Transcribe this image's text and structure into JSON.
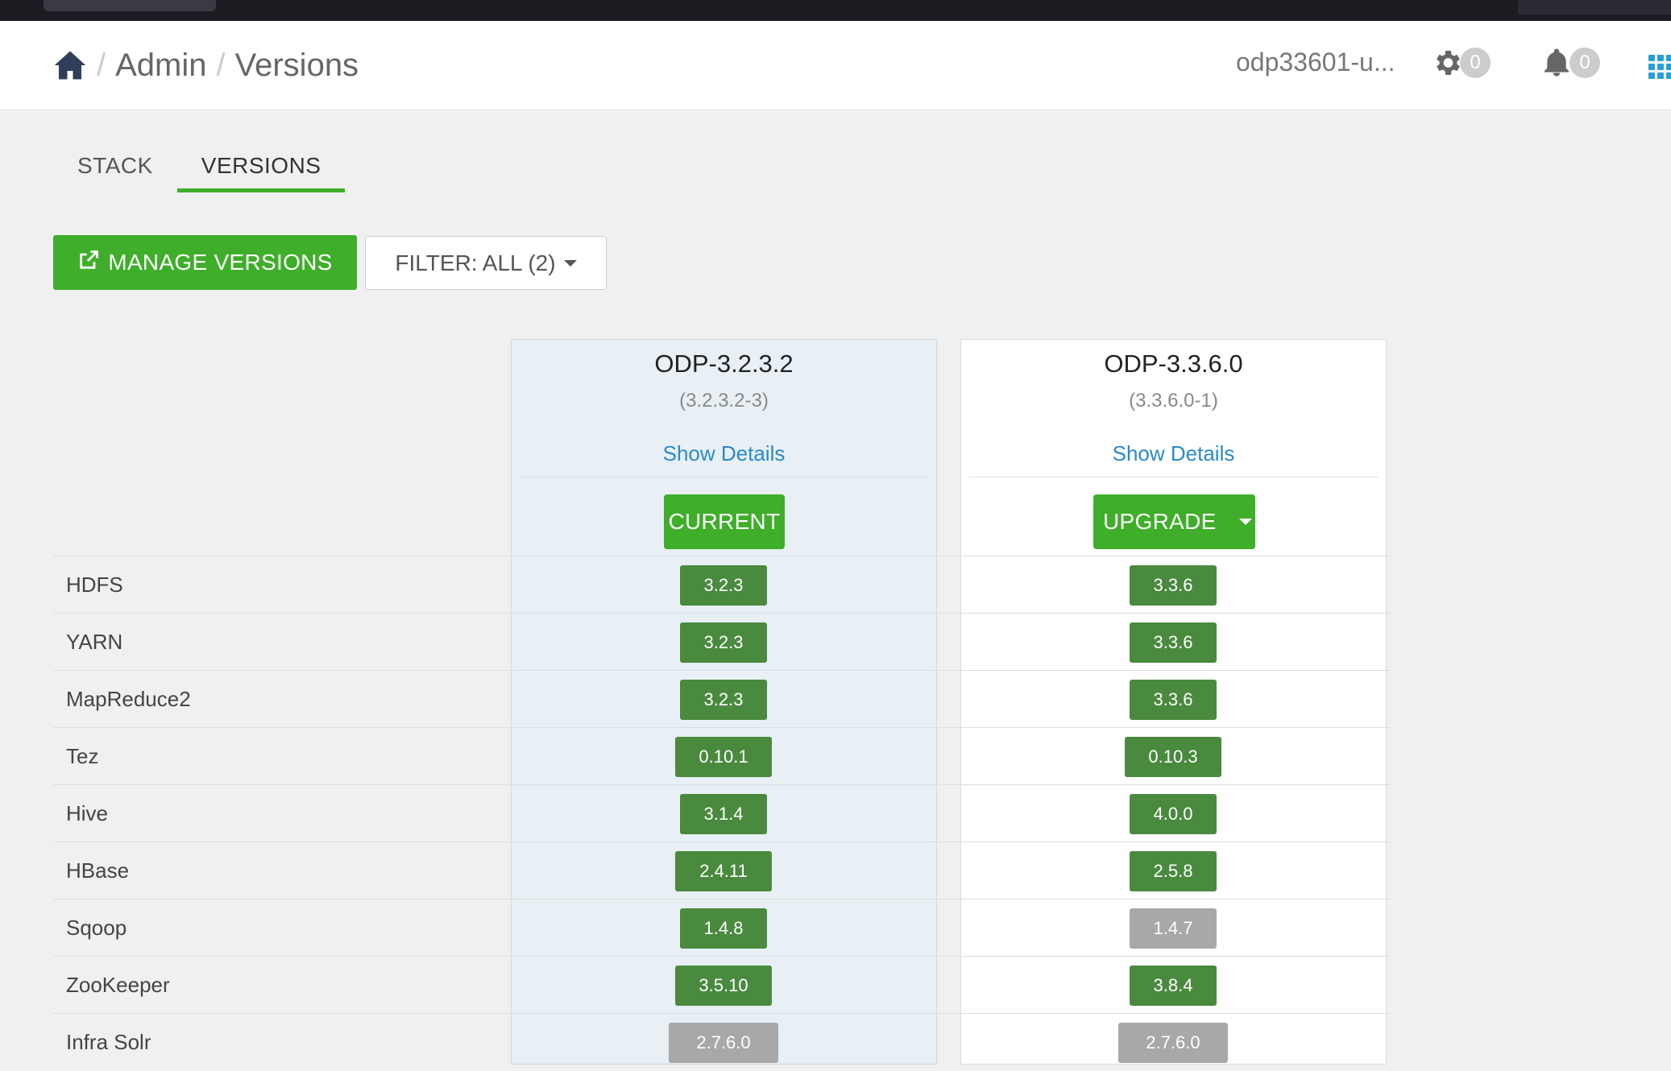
{
  "header": {
    "breadcrumb": [
      "Admin",
      "Versions"
    ],
    "cluster_name": "odp33601-u...",
    "ops_count": "0",
    "alerts_count": "0"
  },
  "tabs": [
    {
      "label": "STACK",
      "active": false
    },
    {
      "label": "VERSIONS",
      "active": true
    }
  ],
  "toolbar": {
    "manage_label": "MANAGE VERSIONS",
    "filter_label": "FILTER: ALL (2)"
  },
  "versions": [
    {
      "name": "ODP-3.2.3.2",
      "build": "(3.2.3.2-3)",
      "details_label": "Show Details",
      "action_label": "CURRENT"
    },
    {
      "name": "ODP-3.3.6.0",
      "build": "(3.3.6.0-1)",
      "details_label": "Show Details",
      "action_label": "UPGRADE"
    }
  ],
  "services": [
    {
      "name": "HDFS",
      "v1": "3.2.3",
      "v1_status": "green",
      "v2": "3.3.6",
      "v2_status": "green"
    },
    {
      "name": "YARN",
      "v1": "3.2.3",
      "v1_status": "green",
      "v2": "3.3.6",
      "v2_status": "green"
    },
    {
      "name": "MapReduce2",
      "v1": "3.2.3",
      "v1_status": "green",
      "v2": "3.3.6",
      "v2_status": "green"
    },
    {
      "name": "Tez",
      "v1": "0.10.1",
      "v1_status": "green",
      "v2": "0.10.3",
      "v2_status": "green"
    },
    {
      "name": "Hive",
      "v1": "3.1.4",
      "v1_status": "green",
      "v2": "4.0.0",
      "v2_status": "green"
    },
    {
      "name": "HBase",
      "v1": "2.4.11",
      "v1_status": "green",
      "v2": "2.5.8",
      "v2_status": "green"
    },
    {
      "name": "Sqoop",
      "v1": "1.4.8",
      "v1_status": "green",
      "v2": "1.4.7",
      "v2_status": "gray"
    },
    {
      "name": "ZooKeeper",
      "v1": "3.5.10",
      "v1_status": "green",
      "v2": "3.8.4",
      "v2_status": "green"
    },
    {
      "name": "Infra Solr",
      "v1": "2.7.6.0",
      "v1_status": "gray",
      "v2": "2.7.6.0",
      "v2_status": "gray"
    }
  ]
}
